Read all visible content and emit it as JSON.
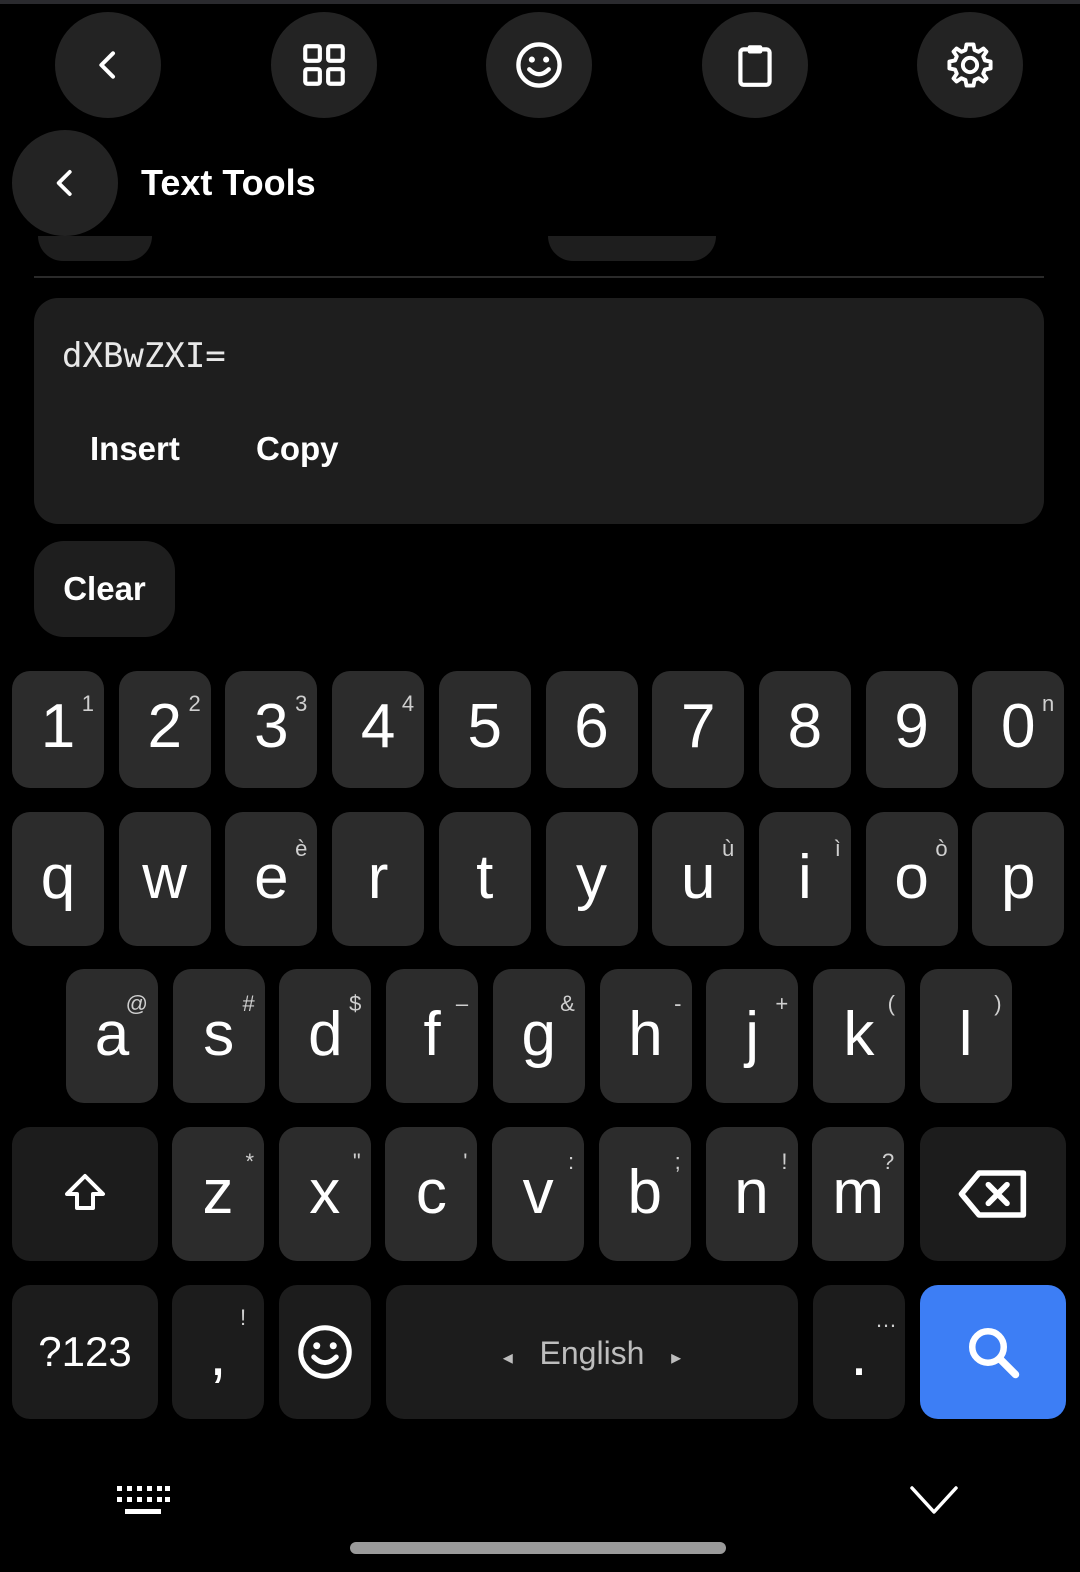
{
  "header": {
    "title": "Text Tools"
  },
  "result": {
    "value": "dXBwZXI=",
    "insert_label": "Insert",
    "copy_label": "Copy"
  },
  "clear_label": "Clear",
  "keyboard": {
    "number_row": [
      {
        "key": "1",
        "hint": "1"
      },
      {
        "key": "2",
        "hint": "2"
      },
      {
        "key": "3",
        "hint": "3"
      },
      {
        "key": "4",
        "hint": "4"
      },
      {
        "key": "5",
        "hint": ""
      },
      {
        "key": "6",
        "hint": ""
      },
      {
        "key": "7",
        "hint": ""
      },
      {
        "key": "8",
        "hint": ""
      },
      {
        "key": "9",
        "hint": ""
      },
      {
        "key": "0",
        "hint": "n"
      }
    ],
    "row1": [
      {
        "key": "q",
        "hint": ""
      },
      {
        "key": "w",
        "hint": ""
      },
      {
        "key": "e",
        "hint": "è"
      },
      {
        "key": "r",
        "hint": ""
      },
      {
        "key": "t",
        "hint": ""
      },
      {
        "key": "y",
        "hint": ""
      },
      {
        "key": "u",
        "hint": "ù"
      },
      {
        "key": "i",
        "hint": "ì"
      },
      {
        "key": "o",
        "hint": "ò"
      },
      {
        "key": "p",
        "hint": ""
      }
    ],
    "row2": [
      {
        "key": "a",
        "hint": "@"
      },
      {
        "key": "s",
        "hint": "#"
      },
      {
        "key": "d",
        "hint": "$"
      },
      {
        "key": "f",
        "hint": "–"
      },
      {
        "key": "g",
        "hint": "&"
      },
      {
        "key": "h",
        "hint": "-"
      },
      {
        "key": "j",
        "hint": "+"
      },
      {
        "key": "k",
        "hint": "("
      },
      {
        "key": "l",
        "hint": ")"
      }
    ],
    "row3": [
      {
        "key": "z",
        "hint": "*"
      },
      {
        "key": "x",
        "hint": "\""
      },
      {
        "key": "c",
        "hint": "'"
      },
      {
        "key": "v",
        "hint": ":"
      },
      {
        "key": "b",
        "hint": ";"
      },
      {
        "key": "n",
        "hint": "!"
      },
      {
        "key": "m",
        "hint": "?"
      }
    ],
    "symbols_label": "?123",
    "comma": {
      "key": ",",
      "hint": "!"
    },
    "period": {
      "key": ".",
      "hint": "…"
    },
    "space_label": "English",
    "space_left_arrow": "◂",
    "space_right_arrow": "▸",
    "accent_color": "#3d7ef5"
  }
}
